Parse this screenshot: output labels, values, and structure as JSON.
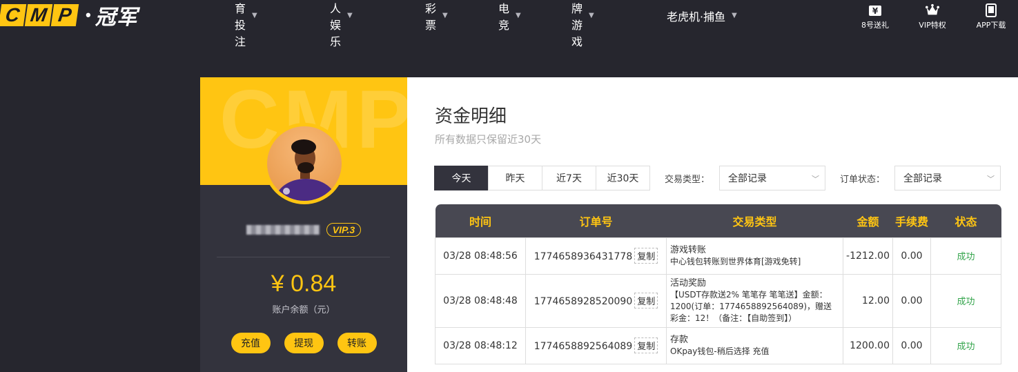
{
  "header": {
    "logo_letters": [
      "C",
      "M",
      "P"
    ],
    "logo_dot": "•",
    "logo_cn": "冠军",
    "nav": [
      {
        "label": "体育投注"
      },
      {
        "label": "真人娱乐"
      },
      {
        "label": "彩票"
      },
      {
        "label": "电竞"
      },
      {
        "label": "棋牌游戏"
      },
      {
        "label": "老虎机·捕鱼"
      }
    ],
    "quick_links": [
      {
        "label": "8号送礼",
        "icon": "gift-yen-icon"
      },
      {
        "label": "VIP特权",
        "icon": "crown-icon"
      },
      {
        "label": "APP下载",
        "icon": "phone-icon"
      }
    ]
  },
  "profile": {
    "watermark": "CMP",
    "vip_level": "VIP.3",
    "balance": "¥ 0.84",
    "balance_label": "账户余额（元）",
    "buttons": [
      "充值",
      "提现",
      "转账"
    ]
  },
  "main": {
    "title": "资金明细",
    "subtitle": "所有数据只保留近30天",
    "range_tabs": [
      {
        "label": "今天",
        "active": true
      },
      {
        "label": "昨天",
        "active": false
      },
      {
        "label": "近7天",
        "active": false
      },
      {
        "label": "近30天",
        "active": false
      }
    ],
    "trade_type_label": "交易类型：",
    "trade_type_value": "全部记录",
    "order_status_label": "订单状态：",
    "order_status_value": "全部记录",
    "table": {
      "columns": [
        "时间",
        "订单号",
        "交易类型",
        "金额",
        "手续费",
        "状态"
      ],
      "copy_label": "复制",
      "rows": [
        {
          "time": "03/28 08:48:56",
          "order_no": "1774658936431778",
          "type_title": "游戏转账",
          "type_detail": "中心钱包转账到世界体育[游戏免转]",
          "amount": "-1212.00",
          "fee": "0.00",
          "status": "成功"
        },
        {
          "time": "03/28 08:48:48",
          "order_no": "1774658928520090",
          "type_title": "活动奖励",
          "type_detail": "【USDT存款送2% 笔笔存 笔笔送】金额：1200(订单：1774658892564089)，赠送彩金：12！（备注：【自助签到】）",
          "amount": "12.00",
          "fee": "0.00",
          "status": "成功"
        },
        {
          "time": "03/28 08:48:12",
          "order_no": "1774658892564089",
          "type_title": "存款",
          "type_detail": "OKpay钱包-稍后选择 充值",
          "amount": "1200.00",
          "fee": "0.00",
          "status": "成功"
        }
      ]
    }
  },
  "colors": {
    "brand_yellow": "#ffc512",
    "dark_bg": "#26262e",
    "panel_bg": "#33333d",
    "success_green": "#33a44b"
  }
}
